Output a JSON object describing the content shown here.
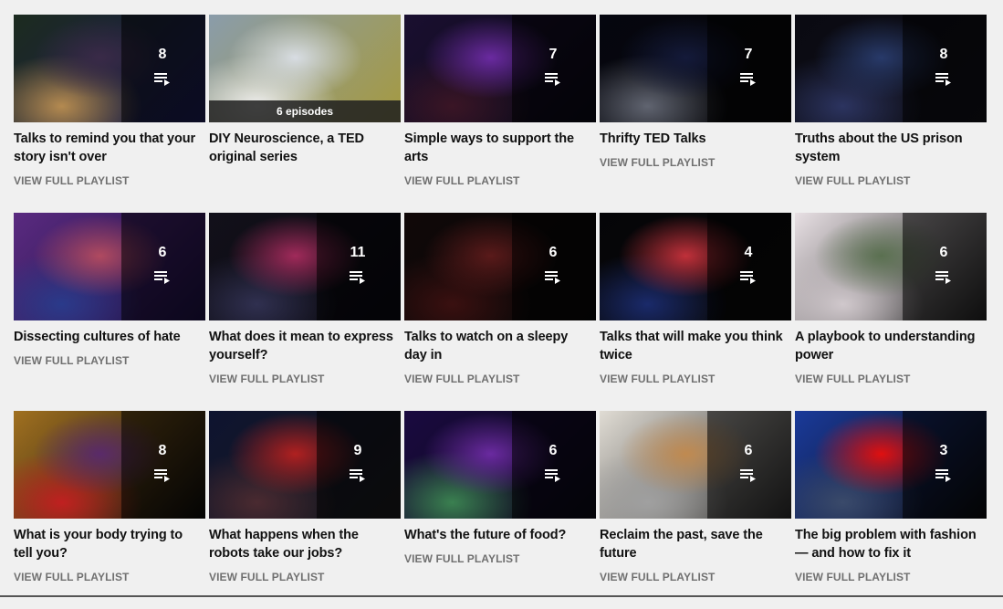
{
  "link_label": "VIEW FULL PLAYLIST",
  "playlists": [
    {
      "title": "Talks to remind you that your story isn't over",
      "count": "8",
      "bg": [
        "#1c2b1f",
        "#3a2a48",
        "#b48a50",
        "#1a1a50"
      ],
      "has_link": true
    },
    {
      "title": "DIY Neuroscience, a TED original series",
      "count": "",
      "episodes": "6 episodes",
      "bg": [
        "#8a9caa",
        "#d8dde3",
        "#f0f0f0",
        "#a59a40"
      ],
      "has_link": false
    },
    {
      "title": "Simple ways to support the arts",
      "count": "7",
      "bg": [
        "#1a0f30",
        "#6a2aa0",
        "#3a1525",
        "#0a0a14"
      ],
      "has_link": true
    },
    {
      "title": "Thrifty TED Talks",
      "count": "7",
      "bg": [
        "#05060f",
        "#141a3a",
        "#606470",
        "#080808"
      ],
      "has_link": true
    },
    {
      "title": "Truths about the US prison system",
      "count": "8",
      "bg": [
        "#0a0a12",
        "#283a6a",
        "#2c3460",
        "#101018"
      ],
      "has_link": true
    },
    {
      "title": "Dissecting cultures of hate",
      "count": "6",
      "bg": [
        "#5a2a80",
        "#b04a60",
        "#2a3a8a",
        "#1a1040"
      ],
      "has_link": true
    },
    {
      "title": "What does it mean to express yourself?",
      "count": "11",
      "bg": [
        "#12101a",
        "#a02a5a",
        "#303050",
        "#0a0a10"
      ],
      "has_link": true
    },
    {
      "title": "Talks to watch on a sleepy day in",
      "count": "6",
      "bg": [
        "#100808",
        "#5a1a1a",
        "#3a1010",
        "#080808"
      ],
      "has_link": true
    },
    {
      "title": "Talks that will make you think twice",
      "count": "4",
      "bg": [
        "#050508",
        "#c0303a",
        "#1a2a6a",
        "#0a0a0a"
      ],
      "has_link": true
    },
    {
      "title": "A playbook to understanding power",
      "count": "6",
      "bg": [
        "#e8e0e4",
        "#5a7050",
        "#d0c8cc",
        "#202020"
      ],
      "has_link": true
    },
    {
      "title": "What is your body trying to tell you?",
      "count": "8",
      "bg": [
        "#a07020",
        "#5a2a6a",
        "#c02020",
        "#0a0a0a"
      ],
      "has_link": true
    },
    {
      "title": "What happens when the robots take our jobs?",
      "count": "9",
      "bg": [
        "#0e1430",
        "#b02020",
        "#4a2a30",
        "#1a1a1a"
      ],
      "has_link": true
    },
    {
      "title": "What's the future of food?",
      "count": "6",
      "bg": [
        "#1a0a40",
        "#6a2aa0",
        "#3a8050",
        "#0a0a14"
      ],
      "has_link": true
    },
    {
      "title": "Reclaim the past, save the future",
      "count": "6",
      "bg": [
        "#e0dcd4",
        "#c08a50",
        "#a0a0a0",
        "#2a2a2a"
      ],
      "has_link": true
    },
    {
      "title": "The big problem with fashion — and how to fix it",
      "count": "3",
      "bg": [
        "#1a3a9a",
        "#e01010",
        "#3a4a6a",
        "#0a0a0a"
      ],
      "has_link": true
    }
  ]
}
